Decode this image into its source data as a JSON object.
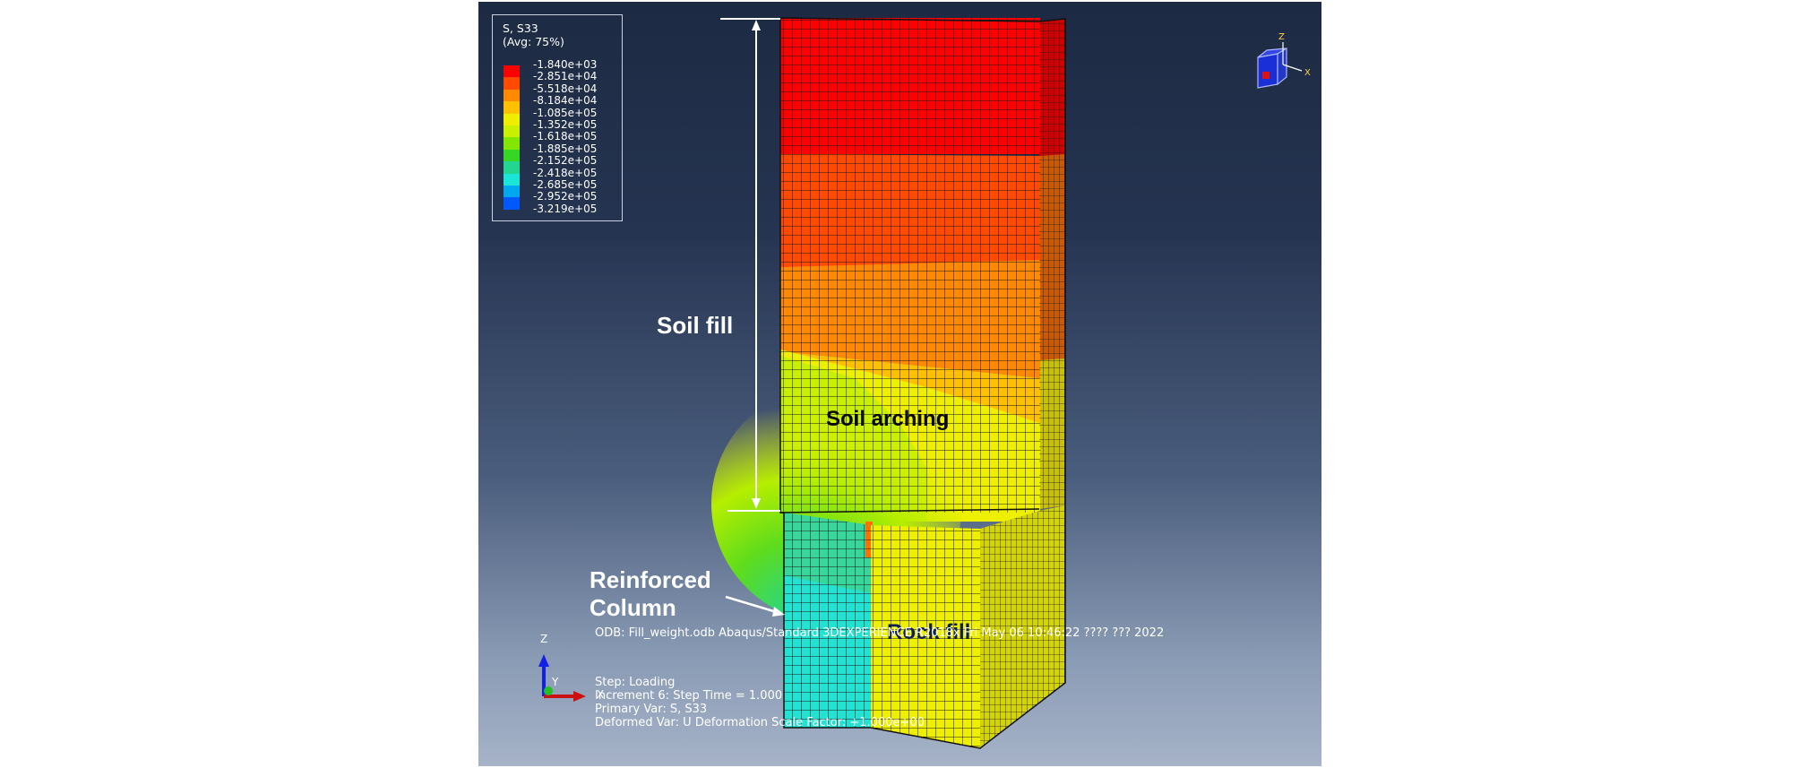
{
  "legend": {
    "variable": "S, S33",
    "averaging": "(Avg: 75%)",
    "values": [
      "-1.840e+03",
      "-2.851e+04",
      "-5.518e+04",
      "-8.184e+04",
      "-1.085e+05",
      "-1.352e+05",
      "-1.618e+05",
      "-1.885e+05",
      "-2.152e+05",
      "-2.418e+05",
      "-2.685e+05",
      "-2.952e+05",
      "-3.219e+05"
    ],
    "colors": [
      "#ff0000",
      "#ff4a00",
      "#ff8a00",
      "#ffc000",
      "#f0ee00",
      "#c8f000",
      "#82e600",
      "#38d624",
      "#22d690",
      "#19e6d6",
      "#00a8f0",
      "#0058ff",
      "#0000e6"
    ]
  },
  "annotations": {
    "soil_fill": "Soil fill",
    "soil_arching": "Soil arching",
    "reinforced_line1": "Reinforced",
    "reinforced_line2": "Column",
    "rock_fill": "Rock fill"
  },
  "info": {
    "odb": "ODB: Fill_weight.odb    Abaqus/Standard 3DEXPERIENCE R2018x    Fri May 06 10:46:22 ???? ??? 2022",
    "step": "Step: Loading",
    "increment": "Increment     6: Step Time =     1.000",
    "primary_var": "Primary Var: S, S33",
    "deformed_var": "Deformed Var: U   Deformation Scale Factor: +1.000e+00"
  },
  "triad": {
    "z": "Z",
    "y": "Y",
    "x": "X"
  },
  "view_cube": {
    "z": "Z",
    "x": "X"
  }
}
